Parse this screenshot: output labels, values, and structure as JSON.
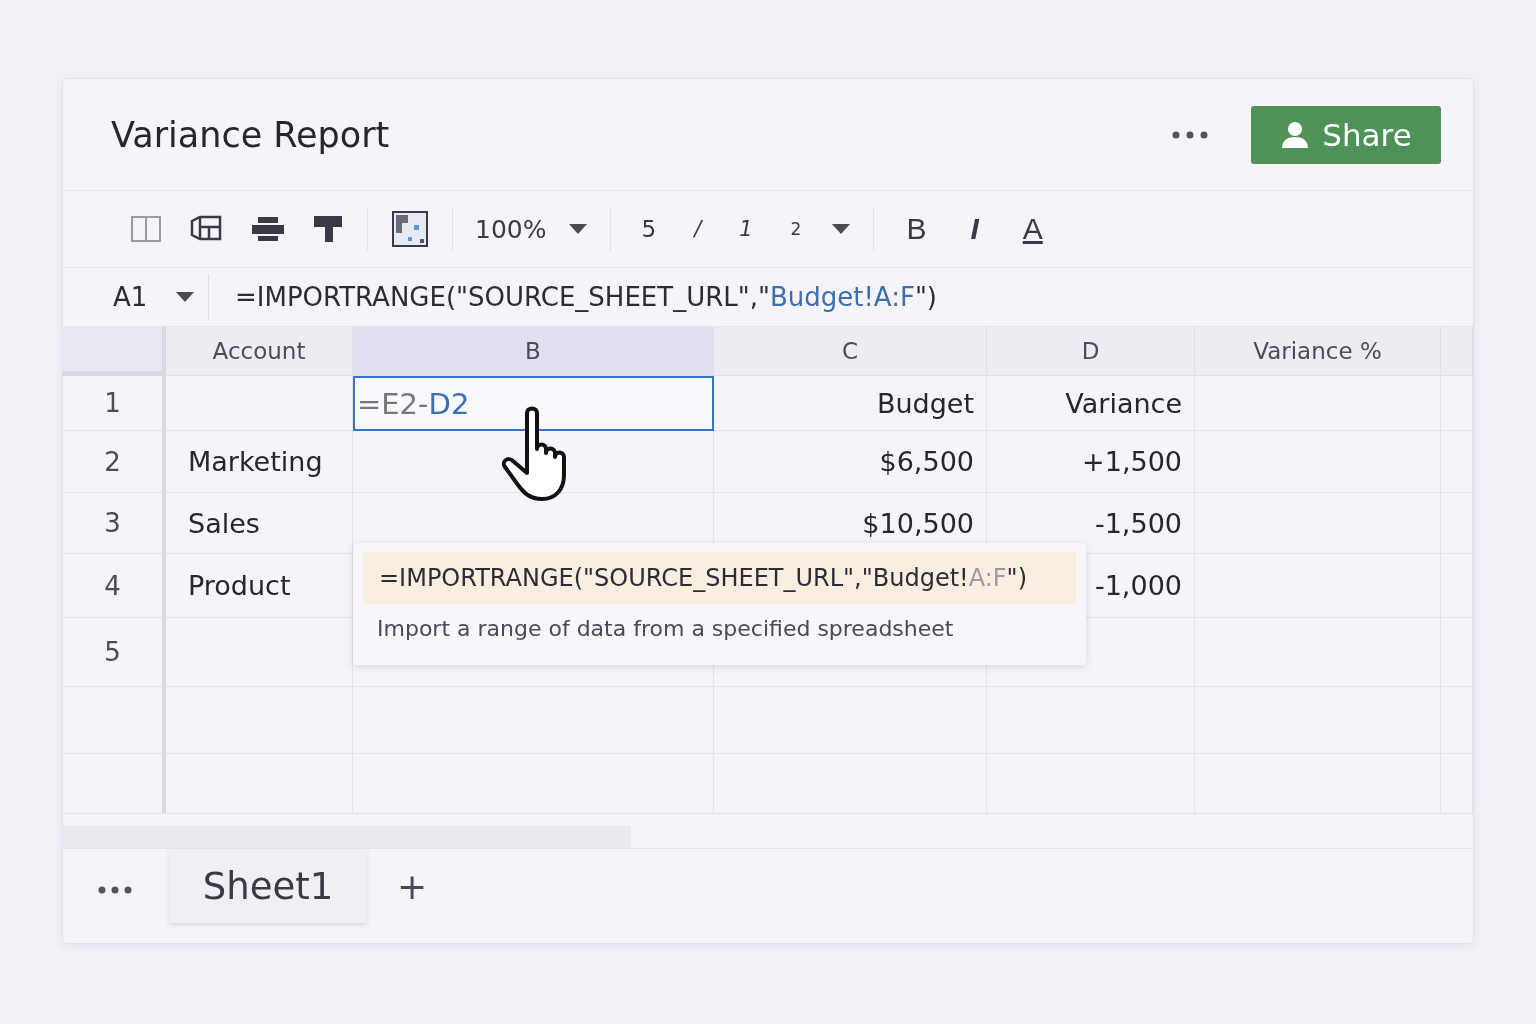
{
  "title": "Variance Report",
  "share": {
    "label": "Share"
  },
  "toolbar": {
    "zoom": "100%",
    "font_size": [
      "5",
      "/",
      "1",
      "2"
    ],
    "format": [
      "B",
      "I",
      "A"
    ]
  },
  "formula_bar": {
    "cell": "A1",
    "parts": [
      {
        "kind": "plain",
        "text": "=IMPORTRANGE(\"SOURCE_SHEET_URL\",\""
      },
      {
        "kind": "ref",
        "text": "Budget!A:F"
      },
      {
        "kind": "plain",
        "text": "\")"
      }
    ]
  },
  "columns": [
    {
      "label": "Account",
      "selected": false
    },
    {
      "label": "B",
      "selected": true
    },
    {
      "label": "C",
      "selected": false
    },
    {
      "label": "D",
      "selected": false
    },
    {
      "label": "Variance %",
      "selected": false
    }
  ],
  "rows": [
    {
      "number": "1",
      "cells": [
        "",
        null,
        "Budget",
        "Variance",
        ""
      ]
    },
    {
      "number": "2",
      "cells": [
        "Marketing",
        "",
        "$6,500",
        "+1,500",
        ""
      ]
    },
    {
      "number": "3",
      "cells": [
        "Sales",
        "",
        "$10,500",
        "-1,500",
        ""
      ]
    },
    {
      "number": "4",
      "cells": [
        "Product",
        "",
        "",
        "-1,000",
        ""
      ]
    },
    {
      "number": "5",
      "cells": [
        "",
        "",
        "",
        "",
        ""
      ]
    }
  ],
  "active_cell": {
    "parts": [
      {
        "kind": "plain",
        "text": "=E2-"
      },
      {
        "kind": "ref",
        "text": "D2"
      }
    ]
  },
  "tooltip": {
    "parts": [
      {
        "kind": "plain",
        "text": "=IMPORTRANGE(\"SOURCE_SHEET_URL\",\"Budget!"
      },
      {
        "kind": "dim",
        "text": "A:F"
      },
      {
        "kind": "plain",
        "text": "\")"
      }
    ],
    "description": "Import a range of data from a specified spreadsheet"
  },
  "sheets": [
    {
      "label": "Sheet1",
      "selected": true
    }
  ],
  "add_sheet": "+"
}
